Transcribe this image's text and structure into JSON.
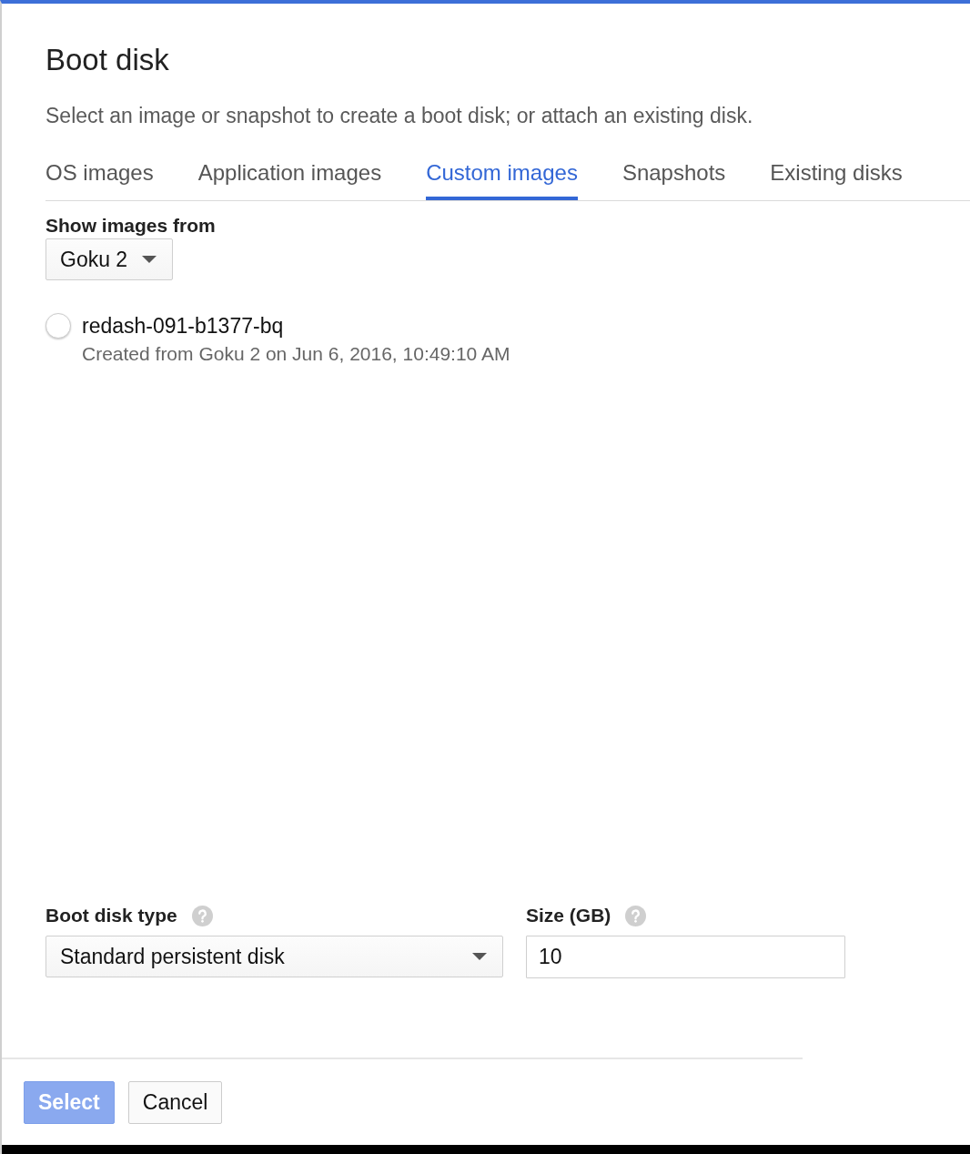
{
  "dialog": {
    "title": "Boot disk",
    "description": "Select an image or snapshot to create a boot disk; or attach an existing disk."
  },
  "tabs": [
    {
      "label": "OS images",
      "selected": false
    },
    {
      "label": "Application images",
      "selected": false
    },
    {
      "label": "Custom images",
      "selected": true
    },
    {
      "label": "Snapshots",
      "selected": false
    },
    {
      "label": "Existing disks",
      "selected": false
    }
  ],
  "image_source": {
    "label": "Show images from",
    "value": "Goku 2"
  },
  "images": [
    {
      "name": "redash-091-b1377-bq",
      "details": "Created from Goku 2 on Jun 6, 2016, 10:49:10 AM",
      "selected": false
    }
  ],
  "disk_type": {
    "label": "Boot disk type",
    "value": "Standard persistent disk"
  },
  "size": {
    "label": "Size (GB)",
    "value": "10"
  },
  "buttons": [
    {
      "label": "Select",
      "kind": "primary",
      "disabled": true
    },
    {
      "label": "Cancel",
      "kind": "secondary",
      "disabled": false
    }
  ]
}
